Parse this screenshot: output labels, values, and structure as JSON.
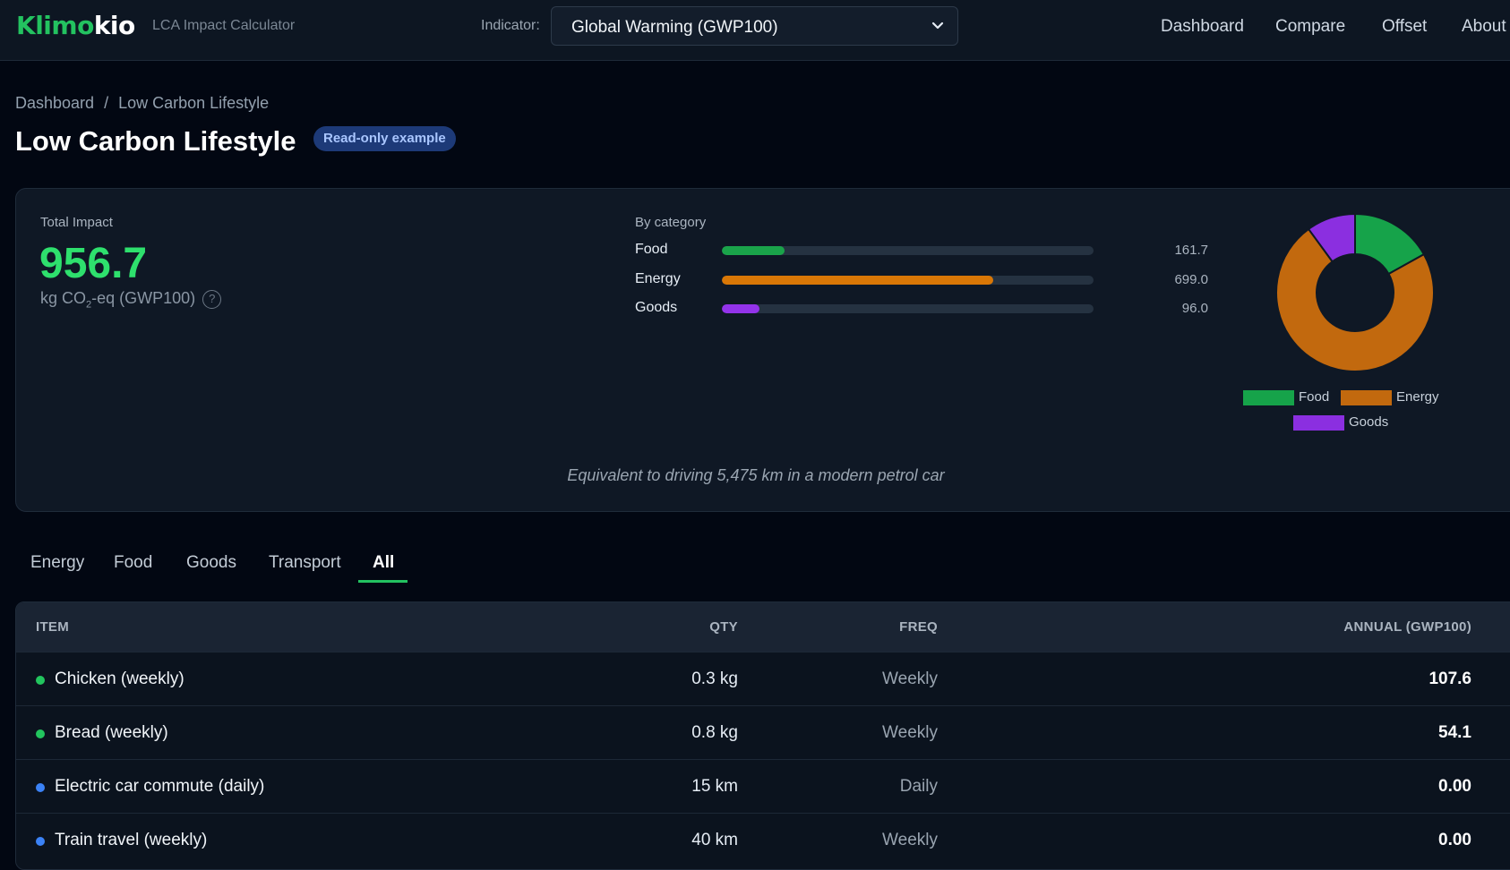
{
  "header": {
    "logo_part1": "Klimo",
    "logo_part2": "kio",
    "subtitle": "LCA Impact Calculator",
    "indicator_label": "Indicator:",
    "indicator_value": "Global Warming (GWP100)",
    "nav": [
      "Dashboard",
      "Compare",
      "Offset",
      "About"
    ]
  },
  "breadcrumb": {
    "root": "Dashboard",
    "sep": "/",
    "current": "Low Carbon Lifestyle"
  },
  "page": {
    "title": "Low Carbon Lifestyle",
    "badge": "Read-only example"
  },
  "summary": {
    "total_label": "Total Impact",
    "total_value": "956.7",
    "unit_prefix": "kg CO",
    "unit_sub": "2",
    "unit_suffix": "-eq (GWP100)",
    "help_glyph": "?",
    "by_category_label": "By category",
    "categories": [
      {
        "name": "Food",
        "value": "161.7",
        "fraction": 0.169,
        "color": "#1aa34a"
      },
      {
        "name": "Energy",
        "value": "699.0",
        "fraction": 0.731,
        "color": "#d97706"
      },
      {
        "name": "Goods",
        "value": "96.0",
        "fraction": 0.1,
        "color": "#9333ea"
      }
    ],
    "donut_colors": {
      "Food": "#16a34a",
      "Energy": "#c2690e",
      "Goods": "#8b2fe0"
    },
    "equivalent": "Equivalent to driving 5,475 km in a modern petrol car"
  },
  "tabs": {
    "items": [
      "Energy",
      "Food",
      "Goods",
      "Transport",
      "All"
    ],
    "active": "All"
  },
  "table": {
    "headers": {
      "item": "ITEM",
      "qty": "QTY",
      "freq": "FREQ",
      "annual": "ANNUAL (GWP100)"
    },
    "rows": [
      {
        "item": "Chicken (weekly)",
        "qty": "0.3 kg",
        "freq": "Weekly",
        "annual": "107.6",
        "dot": "#22c55e"
      },
      {
        "item": "Bread (weekly)",
        "qty": "0.8 kg",
        "freq": "Weekly",
        "annual": "54.1",
        "dot": "#22c55e"
      },
      {
        "item": "Electric car commute (daily)",
        "qty": "15 km",
        "freq": "Daily",
        "annual": "0.00",
        "dot": "#3b82f6"
      },
      {
        "item": "Train travel (weekly)",
        "qty": "40 km",
        "freq": "Weekly",
        "annual": "0.00",
        "dot": "#3b82f6"
      }
    ]
  }
}
